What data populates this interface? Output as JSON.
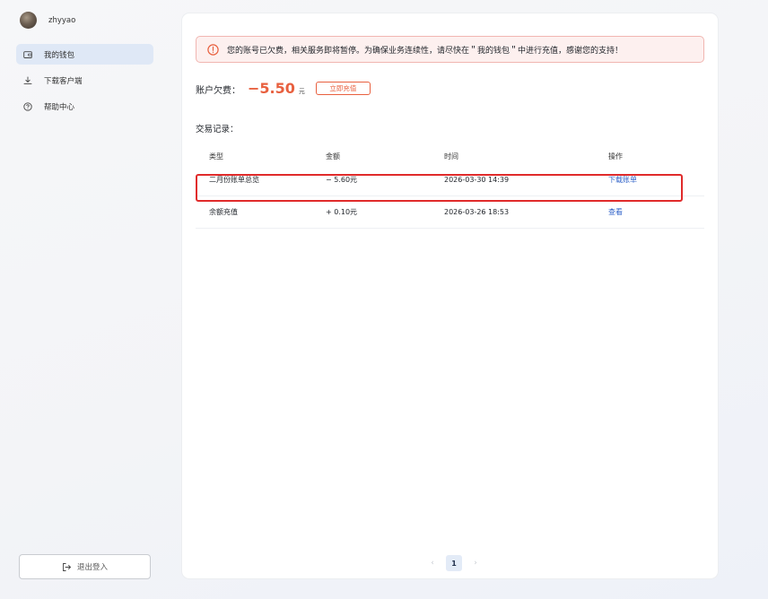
{
  "user": {
    "name": "zhyyao"
  },
  "sidebar": {
    "items": [
      {
        "label": "我的钱包",
        "icon": "wallet-icon",
        "active": true
      },
      {
        "label": "下载客户端",
        "icon": "download-icon",
        "active": false
      },
      {
        "label": "帮助中心",
        "icon": "help-icon",
        "active": false
      }
    ],
    "logout_label": "退出登入"
  },
  "alert": {
    "text": "您的账号已欠费，相关服务即将暂停。为确保业务连续性，请尽快在＂我的钱包＂中进行充值，感谢您的支持！",
    "icon": "warning-circle-icon"
  },
  "balance": {
    "label": "账户欠费：",
    "amount": "−5.50",
    "unit": "元",
    "recharge_label": "立即充值"
  },
  "records": {
    "title": "交易记录：",
    "columns": [
      "类型",
      "金额",
      "时间",
      "操作"
    ],
    "rows": [
      {
        "type": "二月份账单总览",
        "amount": "− 5.60元",
        "time": "2026-03-30 14:39",
        "action": "下载账单"
      },
      {
        "type": "余额充值",
        "amount": "+ 0.10元",
        "time": "2026-03-26 18:53",
        "action": "查看"
      }
    ]
  },
  "pagination": {
    "current": "1",
    "prev": "‹",
    "next": "›"
  },
  "colors": {
    "accent": "#e8603f",
    "link": "#2f62c8",
    "active_nav": "#dfe8f6",
    "highlight": "#e02b2b"
  }
}
